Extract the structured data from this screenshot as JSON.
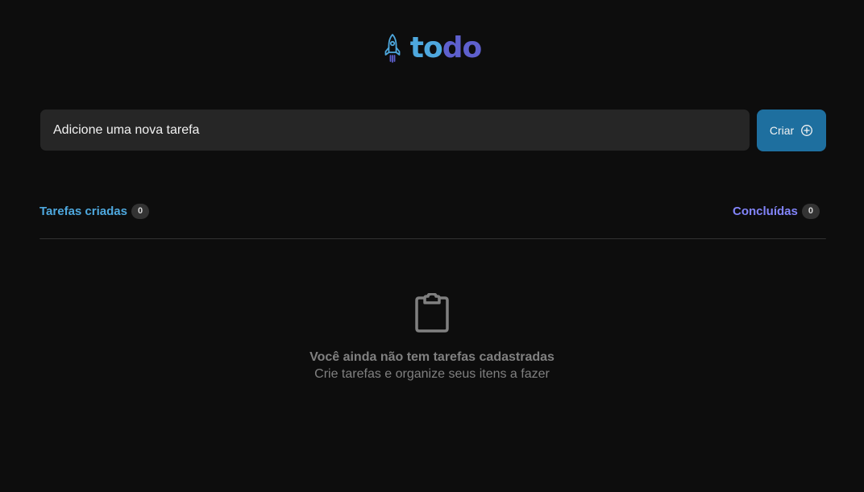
{
  "brand": {
    "text_part1": "to",
    "text_part2": "do",
    "icon": "rocket-icon",
    "colors": {
      "primary": "#4ea8de",
      "secondary": "#5e60ce"
    }
  },
  "new_task": {
    "placeholder": "Adicione uma nova tarefa",
    "button_label": "Criar",
    "button_icon": "plus-circle-icon",
    "button_color": "#1e6f9f"
  },
  "counters": {
    "created": {
      "label": "Tarefas criadas",
      "count": "0",
      "color": "#4ea8de"
    },
    "done": {
      "label": "Concluídas",
      "count": "0",
      "color": "#8284fa"
    }
  },
  "empty_state": {
    "icon": "clipboard-icon",
    "title": "Você ainda não tem tarefas cadastradas",
    "subtitle": "Crie tarefas e organize seus itens a fazer"
  }
}
